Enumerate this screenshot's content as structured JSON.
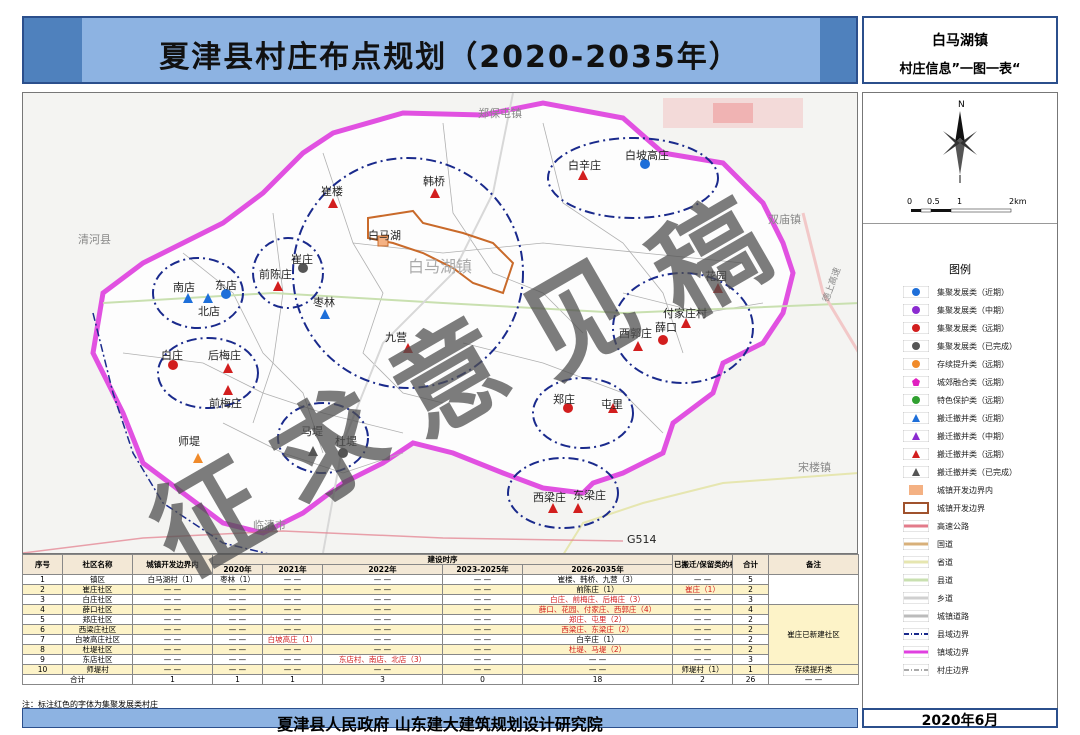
{
  "header": {
    "title": "夏津县村庄布点规划（2020-2035年）"
  },
  "side_header": {
    "town": "白马湖镇",
    "subtitle": "村庄信息”一图一表“"
  },
  "scale": {
    "ticks": [
      "0",
      "0.5",
      "1",
      "2km"
    ]
  },
  "legend": {
    "title": "图例",
    "items": [
      {
        "label": "集聚发展类（近期）",
        "symbol": "circle",
        "color": "#1e6fd9"
      },
      {
        "label": "集聚发展类（中期）",
        "symbol": "circle",
        "color": "#8b2bd0"
      },
      {
        "label": "集聚发展类（远期）",
        "symbol": "circle",
        "color": "#d21e1e"
      },
      {
        "label": "集聚发展类（已完成）",
        "symbol": "circle",
        "color": "#555555"
      },
      {
        "label": "存续提升类（远期）",
        "symbol": "circle",
        "color": "#f08a2a"
      },
      {
        "label": "城郊融合类（远期）",
        "symbol": "pentagon",
        "color": "#e020c0"
      },
      {
        "label": "特色保护类（远期）",
        "symbol": "circle",
        "color": "#30a030"
      },
      {
        "label": "搬迁撤并类（近期）",
        "symbol": "triangle",
        "color": "#1e6fd9"
      },
      {
        "label": "搬迁撤并类（中期）",
        "symbol": "triangle",
        "color": "#8b2bd0"
      },
      {
        "label": "搬迁撤并类（远期）",
        "symbol": "triangle",
        "color": "#d21e1e"
      },
      {
        "label": "搬迁撤并类（已完成）",
        "symbol": "triangle",
        "color": "#555555"
      },
      {
        "label": "城镇开发边界内",
        "symbol": "fill",
        "color": "#f4b183"
      },
      {
        "label": "城镇开发边界",
        "symbol": "outline",
        "color": "#a0522d"
      },
      {
        "label": "高速公路",
        "symbol": "line",
        "color": "#e37b8a"
      },
      {
        "label": "国道",
        "symbol": "line",
        "color": "#d8b07a"
      },
      {
        "label": "省道",
        "symbol": "line",
        "color": "#e6e6b0"
      },
      {
        "label": "县道",
        "symbol": "line",
        "color": "#c9e0b0"
      },
      {
        "label": "乡道",
        "symbol": "line",
        "color": "#d0d0d0"
      },
      {
        "label": "城镇道路",
        "symbol": "line",
        "color": "#bbbbbb"
      },
      {
        "label": "县域边界",
        "symbol": "dashline",
        "color": "#1a2a8c"
      },
      {
        "label": "镇域边界",
        "symbol": "line",
        "color": "#e040e0"
      },
      {
        "label": "村庄边界",
        "symbol": "dashline",
        "color": "#aaaaaa"
      }
    ]
  },
  "map_labels": {
    "zhengbaotun": "郑保屯镇",
    "shuangmiao": "双庙镇",
    "qinghe": "清河县",
    "songlou": "宋楼镇",
    "linqing": "临清市",
    "g514": "G514",
    "baima_lake": "白马湖",
    "baima_lake_big": "白马湖镇",
    "highway": "德上高速",
    "villages": [
      {
        "name": "崔楼",
        "type": "triangle",
        "color": "#d21e1e"
      },
      {
        "name": "韩桥",
        "type": "triangle",
        "color": "#d21e1e"
      },
      {
        "name": "白辛庄",
        "type": "triangle",
        "color": "#d21e1e"
      },
      {
        "name": "白坡高庄",
        "type": "circle",
        "color": "#1e6fd9"
      },
      {
        "name": "白马湖",
        "type": "square",
        "color": "#f4b183"
      },
      {
        "name": "崔庄",
        "type": "circle",
        "color": "#555555"
      },
      {
        "name": "前陈庄",
        "type": "triangle",
        "color": "#d21e1e"
      },
      {
        "name": "南店",
        "type": "triangle",
        "color": "#1e6fd9"
      },
      {
        "name": "东店",
        "type": "circle",
        "color": "#1e6fd9"
      },
      {
        "name": "北店",
        "type": "triangle",
        "color": "#1e6fd9"
      },
      {
        "name": "枣林",
        "type": "triangle",
        "color": "#1e6fd9"
      },
      {
        "name": "九营",
        "type": "triangle",
        "color": "#d21e1e"
      },
      {
        "name": "花园",
        "type": "triangle",
        "color": "#d21e1e"
      },
      {
        "name": "付家庄村",
        "type": "triangle",
        "color": "#d21e1e"
      },
      {
        "name": "薛口",
        "type": "circle",
        "color": "#d21e1e"
      },
      {
        "name": "西郭庄",
        "type": "triangle",
        "color": "#d21e1e"
      },
      {
        "name": "白庄",
        "type": "circle",
        "color": "#d21e1e"
      },
      {
        "name": "后梅庄",
        "type": "triangle",
        "color": "#d21e1e"
      },
      {
        "name": "前梅庄",
        "type": "triangle",
        "color": "#d21e1e"
      },
      {
        "name": "郑庄",
        "type": "circle",
        "color": "#d21e1e"
      },
      {
        "name": "屯里",
        "type": "triangle",
        "color": "#d21e1e"
      },
      {
        "name": "师堤",
        "type": "triangle",
        "color": "#f08a2a"
      },
      {
        "name": "马堤",
        "type": "triangle",
        "color": "#555555"
      },
      {
        "name": "杜堤",
        "type": "circle",
        "color": "#555555"
      },
      {
        "name": "西梁庄",
        "type": "triangle",
        "color": "#d21e1e"
      },
      {
        "name": "东梁庄",
        "type": "triangle",
        "color": "#d21e1e"
      }
    ]
  },
  "table": {
    "headers": {
      "no": "序号",
      "community": "社区名称",
      "within": "城镇开发边界内",
      "build_order": "建设时序",
      "y2020": "2020年",
      "y2021": "2021年",
      "y2022": "2022年",
      "y2023": "2023-2025年",
      "y2026": "2026-2035年",
      "relocated": "已搬迁/保留类的村庄",
      "total": "合计",
      "remark": "备注"
    },
    "rows": [
      {
        "no": "1",
        "community": "镇区",
        "within": "白马湖村（1）",
        "y2020": "枣林（1）",
        "y2021": "— —",
        "y2022": "— —",
        "y2023": "— —",
        "y2026": "崔楼、韩桥、九营（3）",
        "relocated": "— —",
        "total": "5",
        "remark": ""
      },
      {
        "no": "2",
        "community": "崔庄社区",
        "within": "— —",
        "y2020": "— —",
        "y2021": "— —",
        "y2022": "— —",
        "y2023": "— —",
        "y2026": "前陈庄（1）",
        "relocated": "崔庄（1）",
        "total": "2",
        "remark": ""
      },
      {
        "no": "3",
        "community": "白庄社区",
        "within": "— —",
        "y2020": "— —",
        "y2021": "— —",
        "y2022": "— —",
        "y2023": "— —",
        "y2026": "白庄、前梅庄、后梅庄（3）",
        "relocated": "— —",
        "total": "3",
        "remark": ""
      },
      {
        "no": "4",
        "community": "薛口社区",
        "within": "— —",
        "y2020": "— —",
        "y2021": "— —",
        "y2022": "— —",
        "y2023": "— —",
        "y2026": "薛口、花园、付家庄、西郭庄（4）",
        "relocated": "— —",
        "total": "4",
        "remark": "崔庄已新建社区"
      },
      {
        "no": "5",
        "community": "郑庄社区",
        "within": "— —",
        "y2020": "— —",
        "y2021": "— —",
        "y2022": "— —",
        "y2023": "— —",
        "y2026": "郑庄、屯里（2）",
        "relocated": "— —",
        "total": "2",
        "remark": ""
      },
      {
        "no": "6",
        "community": "西梁庄社区",
        "within": "— —",
        "y2020": "— —",
        "y2021": "— —",
        "y2022": "— —",
        "y2023": "— —",
        "y2026": "西梁庄、东梁庄（2）",
        "relocated": "— —",
        "total": "2",
        "remark": ""
      },
      {
        "no": "7",
        "community": "白坡高庄社区",
        "within": "— —",
        "y2020": "— —",
        "y2021": "白坡高庄（1）",
        "y2022": "— —",
        "y2023": "— —",
        "y2026": "白辛庄（1）",
        "relocated": "— —",
        "total": "2",
        "remark": ""
      },
      {
        "no": "8",
        "community": "杜堤社区",
        "within": "— —",
        "y2020": "— —",
        "y2021": "— —",
        "y2022": "— —",
        "y2023": "— —",
        "y2026": "杜堤、马堤（2）",
        "relocated": "— —",
        "total": "2",
        "remark": ""
      },
      {
        "no": "9",
        "community": "东店社区",
        "within": "— —",
        "y2020": "— —",
        "y2021": "— —",
        "y2022": "东店村、南店、北店（3）",
        "y2023": "— —",
        "y2026": "— —",
        "relocated": "— —",
        "total": "3",
        "remark": ""
      },
      {
        "no": "10",
        "community": "师堤村",
        "within": "— —",
        "y2020": "— —",
        "y2021": "— —",
        "y2022": "— —",
        "y2023": "— —",
        "y2026": "— —",
        "relocated": "师堤村（1）",
        "total": "1",
        "remark": "存续提升类"
      }
    ],
    "total_row": {
      "label": "合计",
      "within": "1",
      "y2020": "1",
      "y2021": "1",
      "y2022": "3",
      "y2023": "0",
      "y2026": "18",
      "relocated": "2",
      "total": "26",
      "remark": "— —"
    },
    "note": "注：标注红色的字体为集聚发展类村庄"
  },
  "footer": {
    "org": "夏津县人民政府   山东建大建筑规划设计研究院",
    "date": "2020年6月"
  },
  "watermark": {
    "text": "征求意见稿"
  }
}
